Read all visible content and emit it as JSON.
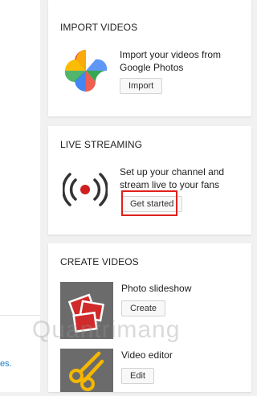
{
  "left_panel": {
    "link_fragment": "es."
  },
  "import_card": {
    "title": "IMPORT VIDEOS",
    "description": "Import your videos from Google Photos",
    "button": "Import",
    "icon": "google-photos-icon"
  },
  "live_card": {
    "title": "LIVE STREAMING",
    "description": "Set up your channel and stream live to your fans",
    "button": "Get started",
    "icon": "live-broadcast-icon",
    "highlight_color": "#e0201c"
  },
  "create_card": {
    "title": "CREATE VIDEOS",
    "items": [
      {
        "label": "Photo slideshow",
        "button": "Create",
        "icon": "photo-slideshow-icon"
      },
      {
        "label": "Video editor",
        "button": "Edit",
        "icon": "video-editor-icon"
      }
    ]
  },
  "watermark": "Quantrimang",
  "colors": {
    "accent_red": "#e0201c",
    "thumb_bg": "#6b6b6b",
    "link": "#167ac6"
  }
}
